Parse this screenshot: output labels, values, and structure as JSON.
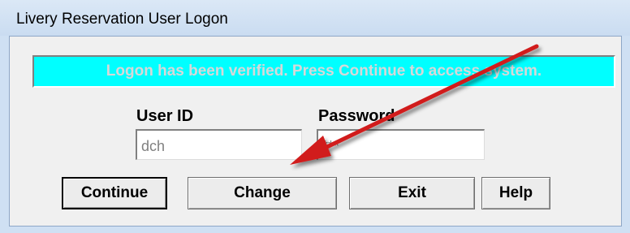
{
  "window": {
    "title": "Livery Reservation User Logon"
  },
  "status": {
    "message": "Logon has been verified.  Press Continue to access system.",
    "background": "#00ffff"
  },
  "fields": {
    "user_id": {
      "label": "User ID",
      "value": "dch"
    },
    "password": {
      "label": "Password",
      "value": "***"
    }
  },
  "buttons": {
    "continue": "Continue",
    "change": "Change",
    "exit": "Exit",
    "help": "Help"
  },
  "annotation": {
    "arrow_color": "#d11a1a"
  }
}
